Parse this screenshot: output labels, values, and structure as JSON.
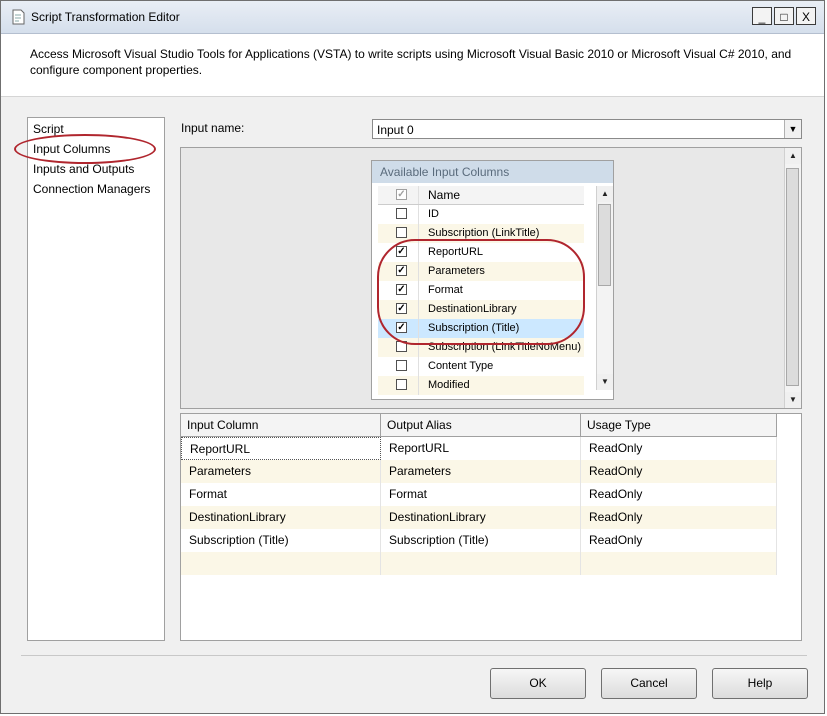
{
  "window": {
    "title": "Script Transformation Editor",
    "controls": {
      "minimize": "_",
      "maximize": "□",
      "close": "X"
    }
  },
  "description": "Access Microsoft Visual Studio Tools for Applications (VSTA) to write scripts using Microsoft Visual Basic 2010 or Microsoft Visual C# 2010, and configure component properties.",
  "nav": {
    "items": [
      "Script",
      "Input Columns",
      "Inputs and Outputs",
      "Connection Managers"
    ],
    "selected": "Input Columns"
  },
  "input_name": {
    "label": "Input name:",
    "value": "Input 0"
  },
  "available_columns": {
    "title": "Available Input Columns",
    "header_name": "Name",
    "rows": [
      {
        "name": "ID",
        "checked": false
      },
      {
        "name": "Subscription (LinkTitle)",
        "checked": false
      },
      {
        "name": "ReportURL",
        "checked": true
      },
      {
        "name": "Parameters",
        "checked": true
      },
      {
        "name": "Format",
        "checked": true
      },
      {
        "name": "DestinationLibrary",
        "checked": true
      },
      {
        "name": "Subscription (Title)",
        "checked": true
      },
      {
        "name": "Subscription (LinkTitleNoMenu)",
        "checked": false
      },
      {
        "name": "Content Type",
        "checked": false
      },
      {
        "name": "Modified",
        "checked": false
      }
    ]
  },
  "mapping": {
    "headers": [
      "Input Column",
      "Output Alias",
      "Usage Type"
    ],
    "rows": [
      [
        "ReportURL",
        "ReportURL",
        "ReadOnly"
      ],
      [
        "Parameters",
        "Parameters",
        "ReadOnly"
      ],
      [
        "Format",
        "Format",
        "ReadOnly"
      ],
      [
        "DestinationLibrary",
        "DestinationLibrary",
        "ReadOnly"
      ],
      [
        "Subscription (Title)",
        "Subscription (Title)",
        "ReadOnly"
      ],
      [
        "",
        "",
        ""
      ]
    ]
  },
  "buttons": {
    "ok": "OK",
    "cancel": "Cancel",
    "help": "Help"
  },
  "icons": {
    "dropdown": "chevron-down-icon",
    "scroll_up": "arrow-up-icon",
    "scroll_down": "arrow-down-icon",
    "checked": "check-icon"
  },
  "colors": {
    "annotation": "#b0262e",
    "alt_row": "#fbf7e7",
    "selected_row": "#cce8ff",
    "panel_header": "#cfdce9"
  }
}
